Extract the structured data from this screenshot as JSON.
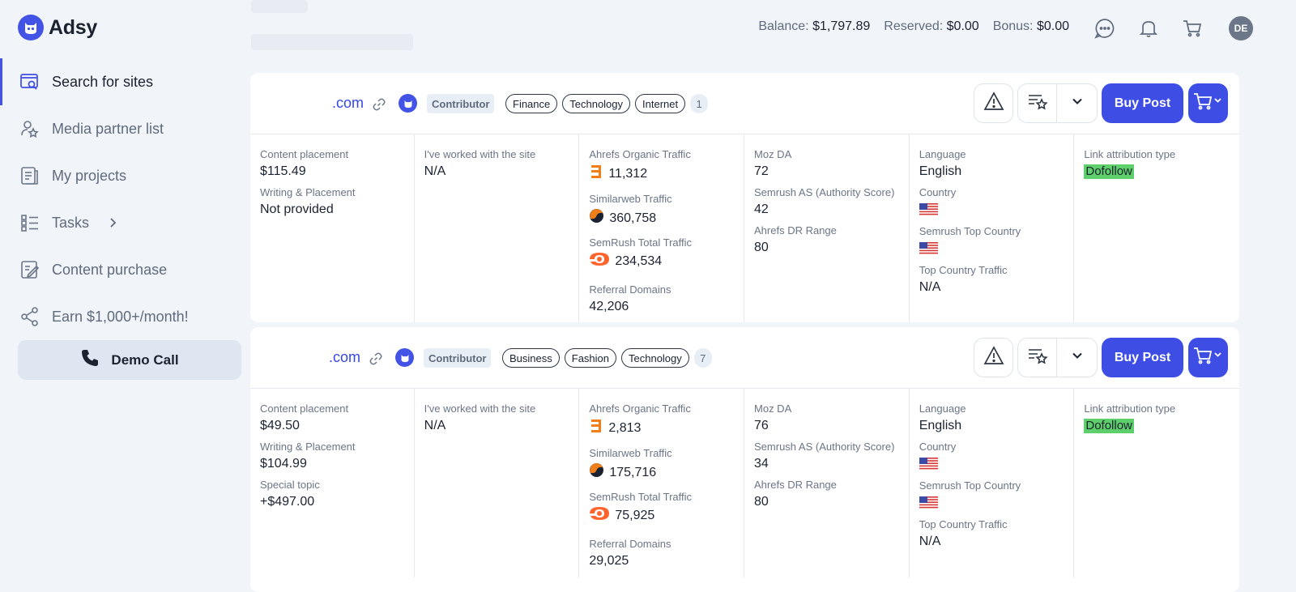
{
  "app": {
    "name": "Adsy"
  },
  "sidebar": {
    "items": [
      {
        "label": "Search for sites",
        "icon": "search-sites-icon",
        "active": true
      },
      {
        "label": "Media partner list",
        "icon": "partner-star-icon"
      },
      {
        "label": "My projects",
        "icon": "projects-icon"
      },
      {
        "label": "Tasks",
        "icon": "tasks-icon"
      },
      {
        "label": "Content purchase",
        "icon": "content-purchase-icon"
      },
      {
        "label": "Earn $1,000+/month!",
        "icon": "share-icon"
      }
    ],
    "demo_call": "Demo Call"
  },
  "header": {
    "balance_label": "Balance:",
    "balance_value": "$1,797.89",
    "reserved_label": "Reserved:",
    "reserved_value": "$0.00",
    "bonus_label": "Bonus:",
    "bonus_value": "$0.00",
    "avatar_initials": "DE"
  },
  "labels": {
    "content_placement": "Content placement",
    "writing_placement": "Writing & Placement",
    "special_topic": "Special topic",
    "worked": "I've worked with the site",
    "ahrefs_traffic": "Ahrefs Organic Traffic",
    "similarweb": "Similarweb Traffic",
    "semrush_traffic": "SemRush Total Traffic",
    "referral": "Referral Domains",
    "moz_da": "Moz DA",
    "semrush_as": "Semrush AS (Authority Score)",
    "ahrefs_dr": "Ahrefs DR Range",
    "language": "Language",
    "country": "Country",
    "semrush_top_country": "Semrush Top Country",
    "top_country_traffic": "Top Country Traffic",
    "link_attr": "Link attribution type",
    "buy_post": "Buy Post"
  },
  "listings": [
    {
      "domain": ".com",
      "role": "Contributor",
      "tags": [
        "Finance",
        "Technology",
        "Internet"
      ],
      "more_count": "1",
      "content_placement": "$115.49",
      "writing_placement": "Not provided",
      "worked": "N/A",
      "ahrefs_traffic": "11,312",
      "similarweb": "360,758",
      "semrush_traffic": "234,534",
      "referral": "42,206",
      "moz_da": "72",
      "semrush_as": "42",
      "ahrefs_dr": "80",
      "language": "English",
      "top_country_traffic": "N/A",
      "link_attr": "Dofollow"
    },
    {
      "domain": ".com",
      "role": "Contributor",
      "tags": [
        "Business",
        "Fashion",
        "Technology"
      ],
      "more_count": "7",
      "content_placement": "$49.50",
      "writing_placement": "$104.99",
      "special_topic": "+$497.00",
      "worked": "N/A",
      "ahrefs_traffic": "2,813",
      "similarweb": "175,716",
      "semrush_traffic": "75,925",
      "referral": "29,025",
      "moz_da": "76",
      "semrush_as": "34",
      "ahrefs_dr": "80",
      "language": "English",
      "top_country_traffic": "N/A",
      "link_attr": "Dofollow"
    }
  ],
  "colors": {
    "accent": "#3e4ee4",
    "dofollow": "#5ed06b",
    "ahrefs": "#f07f1a",
    "semrush": "#ff642d"
  }
}
